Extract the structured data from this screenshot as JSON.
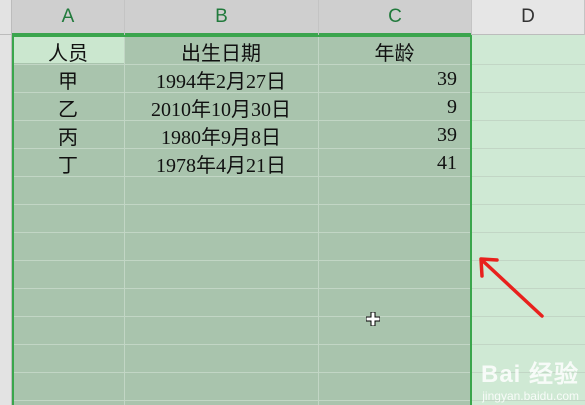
{
  "spreadsheet": {
    "columns": [
      {
        "letter": "A",
        "selected": true
      },
      {
        "letter": "B",
        "selected": true
      },
      {
        "letter": "C",
        "selected": true
      },
      {
        "letter": "D",
        "selected": false
      }
    ],
    "header_row": [
      "人员",
      "出生日期",
      "年龄"
    ],
    "rows": [
      {
        "person": "甲",
        "birth_date": "1994年2月27日",
        "age": "39"
      },
      {
        "person": "乙",
        "birth_date": "2010年10月30日",
        "age": "9"
      },
      {
        "person": "丙",
        "birth_date": "1980年9月8日",
        "age": "39"
      },
      {
        "person": "丁",
        "birth_date": "1978年4月21日",
        "age": "41"
      }
    ]
  },
  "colors": {
    "selection_border": "#3aa64c",
    "selection_fill": "#a9c4ad",
    "unselected_fill": "#cfe9d4",
    "arrow": "#e8211d"
  },
  "icons": {
    "cursor": "cell-select-cross-cursor",
    "annotation": "red-arrow"
  },
  "watermark": {
    "logo": "Bai 经验",
    "url": "jingyan.baidu.com"
  }
}
